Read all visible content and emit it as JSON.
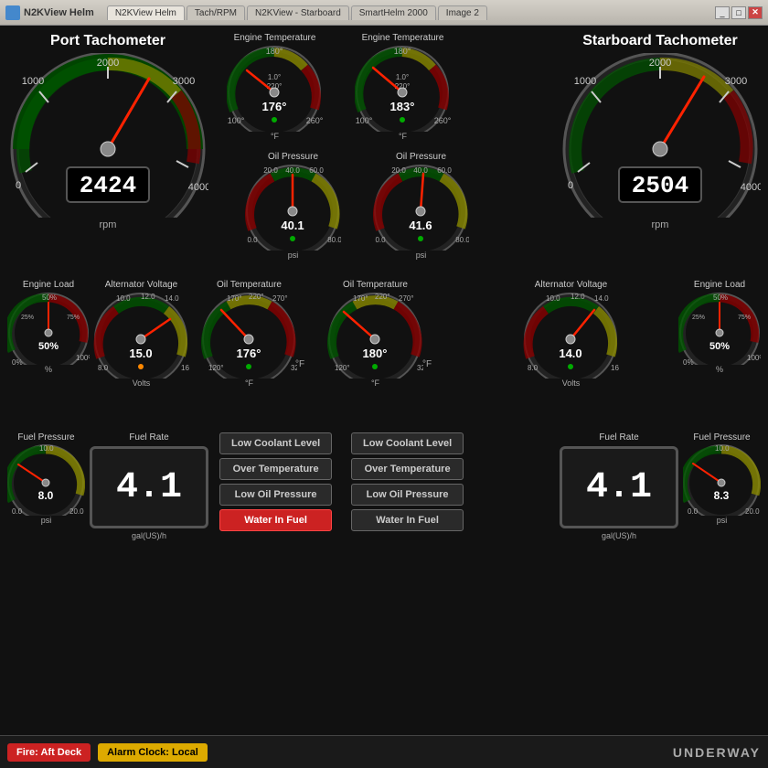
{
  "window": {
    "title": "N2KView Helm",
    "tabs": [
      "N2KView Helm",
      "Tach/RPM",
      "N2KView - Starboard",
      "SmartHelm 2000",
      "Image 2"
    ],
    "active_tab": 0
  },
  "dashboard": {
    "port_tach": {
      "title": "Port Tachometer",
      "value": "2424",
      "unit": "rpm",
      "needle_angle": -15,
      "labels": [
        "0",
        "1000",
        "2000",
        "3000",
        "4000"
      ]
    },
    "starboard_tach": {
      "title": "Starboard Tachometer",
      "value": "2504",
      "unit": "rpm",
      "needle_angle": -10,
      "labels": [
        "0",
        "1000",
        "2000",
        "3000",
        "4000"
      ]
    },
    "port_engine_temp": {
      "label": "Engine Temperature",
      "value": "176°",
      "unit": "°F",
      "min": 100,
      "max": 260
    },
    "stbd_engine_temp": {
      "label": "Engine Temperature",
      "value": "183°",
      "unit": "°F"
    },
    "port_oil_pressure": {
      "label": "Oil Pressure",
      "value": "40.1",
      "unit": "psi"
    },
    "stbd_oil_pressure": {
      "label": "Oil Pressure",
      "value": "41.6",
      "unit": "psi"
    },
    "port_engine_load": {
      "label": "Engine Load",
      "value": "50%",
      "unit": "%"
    },
    "stbd_engine_load": {
      "label": "Engine Load",
      "value": "50%",
      "unit": "%"
    },
    "port_alternator": {
      "label": "Alternator Voltage",
      "value": "15.0",
      "unit": "Volts"
    },
    "stbd_alternator": {
      "label": "Alternator Voltage",
      "value": "14.0",
      "unit": "Volts"
    },
    "port_oil_temp": {
      "label": "Oil Temperature",
      "value": "176°",
      "unit": "°F"
    },
    "stbd_oil_temp": {
      "label": "Oil Temperature",
      "value": "180°",
      "unit": "°F"
    },
    "port_fuel_pressure": {
      "label": "Fuel Pressure",
      "value": "8.0",
      "unit": "psi"
    },
    "stbd_fuel_pressure": {
      "label": "Fuel Pressure",
      "value": "8.3",
      "unit": "psi"
    },
    "port_fuel_rate": {
      "label": "Fuel Rate",
      "value": "4.1",
      "unit": "gal(US)/h"
    },
    "stbd_fuel_rate": {
      "label": "Fuel Rate",
      "value": "4.1",
      "unit": "gal(US)/h"
    },
    "port_alarms": [
      {
        "label": "Low Coolant Level",
        "active": false
      },
      {
        "label": "Over Temperature",
        "active": false
      },
      {
        "label": "Low Oil Pressure",
        "active": false
      },
      {
        "label": "Water In Fuel",
        "active": true
      }
    ],
    "stbd_alarms": [
      {
        "label": "Low Coolant Level",
        "active": false
      },
      {
        "label": "Over Temperature",
        "active": false
      },
      {
        "label": "Low Oil Pressure",
        "active": false
      },
      {
        "label": "Water In Fuel",
        "active": false
      }
    ]
  },
  "status_bar": {
    "fire_text": "Fire: Aft Deck",
    "alarm_text": "Alarm Clock: Local",
    "mode_text": "UNDERWAY"
  },
  "colors": {
    "background": "#111111",
    "gauge_bg": "#1a1a1a",
    "gauge_border": "#444444",
    "green_zone": "#00aa00",
    "yellow_zone": "#aaaa00",
    "red_zone": "#cc0000",
    "needle": "#ff2200",
    "text_primary": "#ffffff",
    "text_secondary": "#aaaaaa"
  }
}
